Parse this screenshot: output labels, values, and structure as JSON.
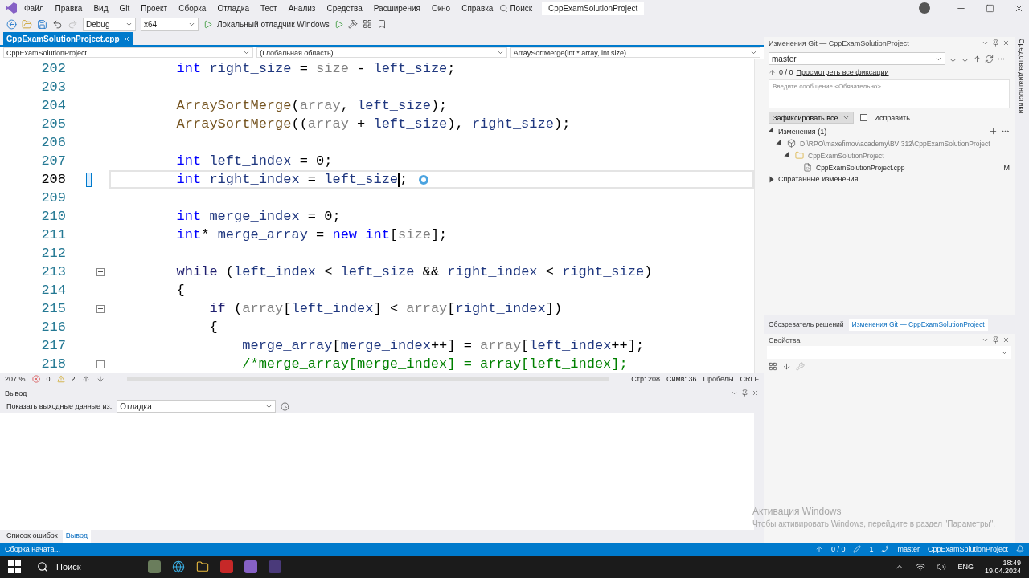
{
  "menu": {
    "items": [
      "Файл",
      "Правка",
      "Вид",
      "Git",
      "Проект",
      "Сборка",
      "Отладка",
      "Тест",
      "Анализ",
      "Средства",
      "Расширения",
      "Окно",
      "Справка"
    ],
    "search": "Поиск",
    "solution": "CppExamSolutionProject"
  },
  "toolbar": {
    "configuration": "Debug",
    "platform": "x64",
    "debugger": "Локальный отладчик Windows"
  },
  "document_tabs": [
    {
      "label": "CppExamSolutionProject.cpp",
      "selected": true
    }
  ],
  "nav_bar": {
    "project": "CppExamSolutionProject",
    "scope": "(Глобальная область)",
    "member": "ArraySortMerge(int * array, int size)"
  },
  "editor": {
    "lines": [
      {
        "number": "202",
        "fold": false,
        "current": false,
        "tokens": [
          {
            "kw": "        int"
          },
          {
            "var": " right_size"
          },
          {
            "p": " = "
          },
          {
            "param": "size"
          },
          {
            "p": " - "
          },
          {
            "var": "left_size"
          },
          {
            "p": ";"
          }
        ]
      },
      {
        "number": "203",
        "fold": false,
        "current": false
      },
      {
        "number": "204",
        "fold": false,
        "current": false,
        "tokens": [
          {
            "fn": "        ArraySortMerge"
          },
          {
            "p": "("
          },
          {
            "param": "array"
          },
          {
            "p": ", "
          },
          {
            "var": "left_size"
          },
          {
            "p": ");"
          }
        ]
      },
      {
        "number": "205",
        "fold": false,
        "current": false,
        "tokens": [
          {
            "fn": "        ArraySortMerge"
          },
          {
            "p": "(("
          },
          {
            "param": "array"
          },
          {
            "p": " + "
          },
          {
            "var": "left_size"
          },
          {
            "p": "), "
          },
          {
            "var": "right_size"
          },
          {
            "p": ");"
          }
        ]
      },
      {
        "number": "206",
        "fold": false,
        "current": false
      },
      {
        "number": "207",
        "fold": false,
        "current": false,
        "tokens": [
          {
            "kw": "        int"
          },
          {
            "var": " left_index"
          },
          {
            "p": " = 0;"
          }
        ]
      },
      {
        "number": "208",
        "fold": false,
        "current": true,
        "tokens": [
          {
            "kw": "        int"
          },
          {
            "var": " right_index"
          },
          {
            "p": " = "
          },
          {
            "var": "left_size",
            "caret": true
          },
          {
            "p": ";"
          }
        ]
      },
      {
        "number": "209",
        "fold": false,
        "current": false
      },
      {
        "number": "210",
        "fold": false,
        "current": false,
        "tokens": [
          {
            "kw": "        int"
          },
          {
            "var": " merge_index"
          },
          {
            "p": " = 0;"
          }
        ]
      },
      {
        "number": "211",
        "fold": false,
        "current": false,
        "tokens": [
          {
            "kw": "        int"
          },
          {
            "p": "* "
          },
          {
            "var": "merge_array"
          },
          {
            "p": " = "
          },
          {
            "kw": "new"
          },
          {
            "kw": " int"
          },
          {
            "p": "["
          },
          {
            "param": "size"
          },
          {
            "p": "];"
          }
        ]
      },
      {
        "number": "212",
        "fold": false,
        "current": false
      },
      {
        "number": "213",
        "fold": true,
        "current": false,
        "tokens": [
          {
            "ctl": "        while"
          },
          {
            "p": " ("
          },
          {
            "var": "left_index"
          },
          {
            "p": " < "
          },
          {
            "var": "left_size"
          },
          {
            "p": " && "
          },
          {
            "var": "right_index"
          },
          {
            "p": " < "
          },
          {
            "var": "right_size"
          },
          {
            "p": ")"
          }
        ]
      },
      {
        "number": "214",
        "fold": false,
        "current": false,
        "tokens": [
          {
            "p": "        {"
          }
        ]
      },
      {
        "number": "215",
        "fold": true,
        "current": false,
        "tokens": [
          {
            "ctl": "            if"
          },
          {
            "p": " ("
          },
          {
            "param": "array"
          },
          {
            "p": "["
          },
          {
            "var": "left_index"
          },
          {
            "p": "] < "
          },
          {
            "param": "array"
          },
          {
            "p": "["
          },
          {
            "var": "right_index"
          },
          {
            "p": "])"
          }
        ]
      },
      {
        "number": "216",
        "fold": false,
        "current": false,
        "tokens": [
          {
            "p": "            {"
          }
        ]
      },
      {
        "number": "217",
        "fold": false,
        "current": false,
        "tokens": [
          {
            "var": "                merge_array"
          },
          {
            "p": "["
          },
          {
            "var": "merge_index"
          },
          {
            "p": "++] = "
          },
          {
            "param": "array"
          },
          {
            "p": "["
          },
          {
            "var": "left_index"
          },
          {
            "p": "++];"
          }
        ]
      },
      {
        "number": "218",
        "fold": true,
        "current": false,
        "tokens": [
          {
            "cm": "                /*merge_array[merge_index] = array[left_index];"
          }
        ]
      }
    ]
  },
  "editor_status": {
    "zoom": "207 %",
    "errors": "0",
    "warnings": "2",
    "line": "Стр: 208",
    "column": "Симв: 36",
    "indent": "Пробелы",
    "eol": "CRLF"
  },
  "output": {
    "title": "Вывод",
    "source_label": "Показать выходные данные из:",
    "source": "Отладка"
  },
  "bottom_tabs": [
    {
      "label": "Список ошибок",
      "selected": false
    },
    {
      "label": "Вывод",
      "selected": true
    }
  ],
  "git": {
    "title": "Изменения Git — CppExamSolutionProject",
    "branch": "master",
    "sync": "0 / 0",
    "history_link": "Просмотреть все фиксации",
    "message_placeholder": "Введите сообщение <Обязательно>",
    "commit": "Зафиксировать все",
    "amend": {
      "label": "Исправить",
      "checked": false
    },
    "changes": {
      "label": "Изменения (1)",
      "expanded": true,
      "children": [
        {
          "label": "D:\\RPO\\maxefimov\\academy\\BV 312\\CppExamSolutionProject",
          "kind": "repo",
          "expanded": true,
          "children": [
            {
              "label": "CppExamSolutionProject",
              "kind": "folder",
              "expanded": true,
              "children": [
                {
                  "label": "CppExamSolutionProject.cpp",
                  "kind": "file",
                  "status": "M"
                }
              ]
            }
          ]
        }
      ]
    },
    "stashed": {
      "label": "Спратанные изменения",
      "expanded": false
    }
  },
  "panel_tabs": [
    {
      "label": "Обозреватель решений",
      "selected": false
    },
    {
      "label": "Изменения Git — CppExamSolutionProject",
      "selected": true
    }
  ],
  "properties": {
    "title": "Свойства"
  },
  "side_strip": {
    "label": "Средства диагностики"
  },
  "status_bar": {
    "message": "Сборка начата...",
    "sync": "0 / 0",
    "changes": "1",
    "branch": "master",
    "solution": "CppExamSolutionProject"
  },
  "activation": {
    "title": "Активация Windows",
    "hint": "Чтобы активировать Windows, перейдите в раздел \"Параметры\"."
  },
  "taskbar": {
    "search": "Поиск",
    "lang": "ENG",
    "time": "18:49",
    "date": "19.04.2024"
  }
}
